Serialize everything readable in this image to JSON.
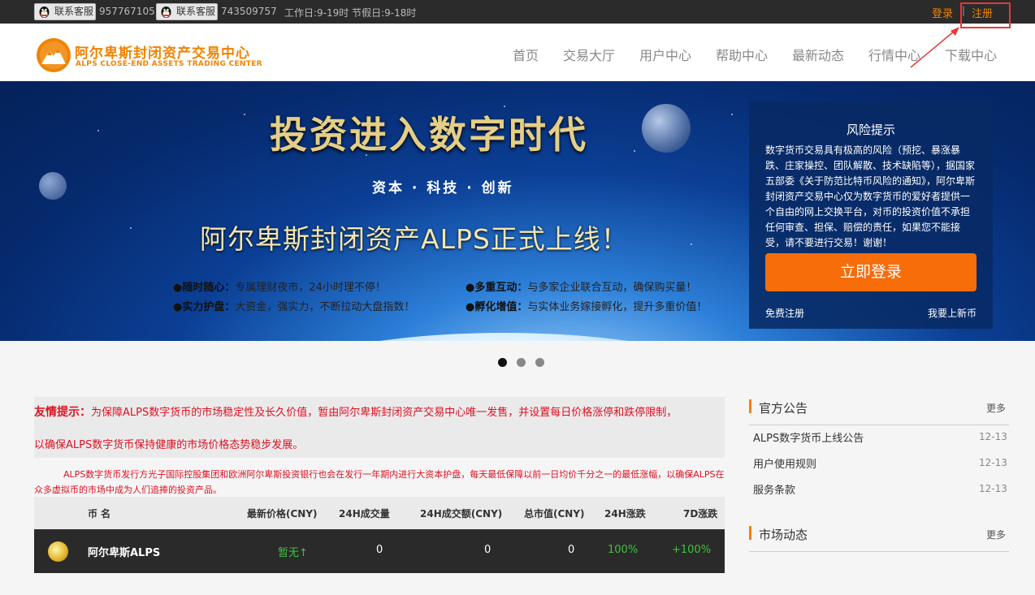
{
  "topbar": {
    "service_label": "联系客服",
    "qq1": "957767105",
    "qq2": "743509757",
    "hours": "工作日:9-19时 节假日:9-18时",
    "login": "登录",
    "separator": "|",
    "register": "注册"
  },
  "brand": {
    "name_cn": "阿尔卑斯封闭资产交易中心",
    "name_en": "ALPS CLOSE-END ASSETS TRADING CENTER",
    "primary_color": "#f08300"
  },
  "nav": [
    "首页",
    "交易大厅",
    "用户中心",
    "帮助中心",
    "最新动态",
    "行情中心",
    "下载中心"
  ],
  "banner": {
    "title": "投资进入数字时代",
    "subtitle": "资本 · 科技 ·  创新",
    "headline": "阿尔卑斯封闭资产ALPS正式上线！",
    "features": [
      {
        "label": "●随时随心：",
        "text": "专属理财夜市，24小时理不停！"
      },
      {
        "label": "●多重互动：",
        "text": "与多家企业联合互动，确保购买量！"
      },
      {
        "label": "●实力护盘：",
        "text": "大资金，强实力，不断拉动大盘指数！"
      },
      {
        "label": "●孵化增值：",
        "text": "与实体业务嫁接孵化，提升多重价值！"
      }
    ]
  },
  "risk": {
    "title": "风险提示",
    "body": "数字货币交易具有极高的风险（预挖、暴涨暴跌、庄家操控、团队解散、技术缺陷等），据国家五部委《关于防范比特币风险的通知》，阿尔卑斯封闭资产交易中心仅为数字货币的爱好者提供一个自由的网上交换平台，对币的投资价值不承担任何审查、担保、赔偿的责任，如果您不能接受，请不要进行交易！谢谢！",
    "login_button": "立即登录",
    "free_register": "免费注册",
    "list_coin": "我要上新币"
  },
  "carousel": {
    "count": 3,
    "active": 0
  },
  "notice": {
    "label": "友情提示：",
    "line1": "为保障ALPS数字货币的市场稳定性及长久价值，暂由阿尔卑斯封闭资产交易中心唯一发售，并设置每日价格涨停和跌停限制，",
    "line2": "以确保ALPS数字货币保持健康的市场价格态势稳步发展。",
    "desc": "ALPS数字货币发行方光子国际控股集团和欧洲阿尔卑斯投资银行也会在发行一年期内进行大资本护盘，每天最低保障以前一日均价千分之一的最低涨幅，以确保ALPS在众多虚拟币的市场中成为人们追捧的投资产品。"
  },
  "market_table": {
    "headers": [
      "币 名",
      "最新价格(CNY)",
      "24H成交量",
      "24H成交额(CNY)",
      "总市值(CNY)",
      "24H涨跌",
      "7D涨跌"
    ],
    "rows": [
      {
        "name": "阿尔卑斯ALPS",
        "price": "暂无↑",
        "volume": "0",
        "turnover": "0",
        "market_cap": "0",
        "change_24h": "100%",
        "change_7d": "+100%"
      }
    ],
    "up_color": "#3ec43e"
  },
  "announcements": {
    "title": "官方公告",
    "more": "更多",
    "items": [
      {
        "title": "ALPS数字货币上线公告",
        "date": "12-13"
      },
      {
        "title": "用户使用规则",
        "date": "12-13"
      },
      {
        "title": "服务条款",
        "date": "12-13"
      }
    ]
  },
  "market_news": {
    "title": "市场动态",
    "more": "更多"
  }
}
